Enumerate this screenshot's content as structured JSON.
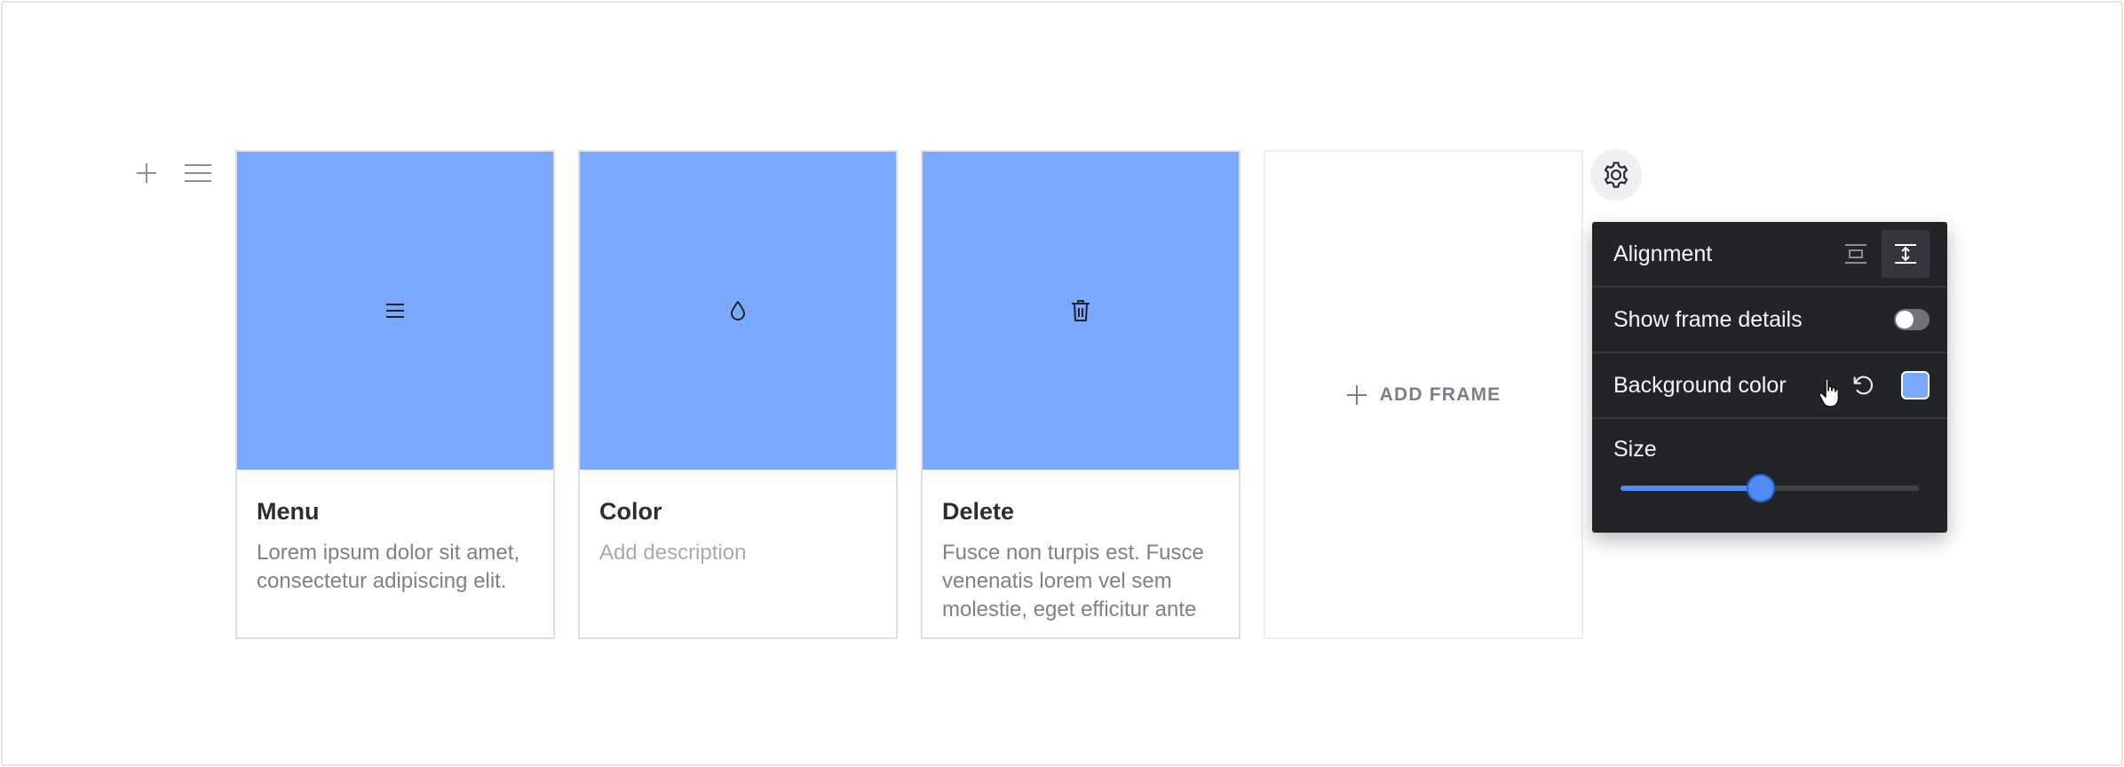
{
  "toolbar": {
    "add_icon": "plus-icon",
    "menu_icon": "menu-icon"
  },
  "frames": [
    {
      "title": "Menu",
      "description": "Lorem ipsum dolor sit amet, consectetur adipiscing elit.",
      "icon": "menu-icon",
      "color": "#7aa8ff"
    },
    {
      "title": "Color",
      "description": "Add description",
      "icon": "droplet-icon",
      "color": "#7aa8ff"
    },
    {
      "title": "Delete",
      "description": "Fusce non turpis est. Fusce venenatis lorem vel sem molestie, eget efficitur ante",
      "icon": "trash-icon",
      "color": "#7aa8ff"
    }
  ],
  "add_frame": {
    "label": "ADD FRAME",
    "icon": "plus-icon"
  },
  "settings": {
    "gear_icon": "gear-icon",
    "alignment_label": "Alignment",
    "show_details_label": "Show frame details",
    "show_details_on": false,
    "background_label": "Background color",
    "background_value": "#7aa8ff",
    "size_label": "Size",
    "size_percent": 47
  },
  "colors": {
    "frame_blue": "#7aa8ff",
    "panel_bg": "#222528",
    "slider_accent": "#4f8cf7"
  }
}
